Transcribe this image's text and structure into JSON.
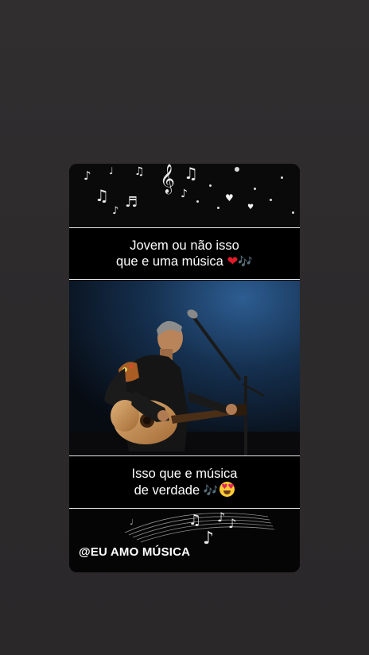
{
  "story": {
    "caption_top": {
      "line1": "Jovem ou não isso",
      "line2": "que e uma música",
      "emoji_heart": "❤",
      "emoji_notes": "🎶"
    },
    "caption_bottom": {
      "line1": "Isso que e música",
      "line2": "de verdade",
      "emoji_notes": "🎶"
    },
    "handle": "@EU AMO MÚSICA"
  },
  "icons": {
    "notes": [
      "eighth-note-icon",
      "treble-clef-icon",
      "beamed-notes-icon",
      "heart-icon"
    ],
    "emoji": [
      "red-heart-emoji",
      "musical-notes-emoji",
      "heart-eyes-emoji"
    ]
  },
  "colors": {
    "background": "#2c2a2b",
    "card": "#050505",
    "caption_text": "#ffffff",
    "heart": "#e21b2a",
    "stage_light": "#1f4a7a"
  }
}
